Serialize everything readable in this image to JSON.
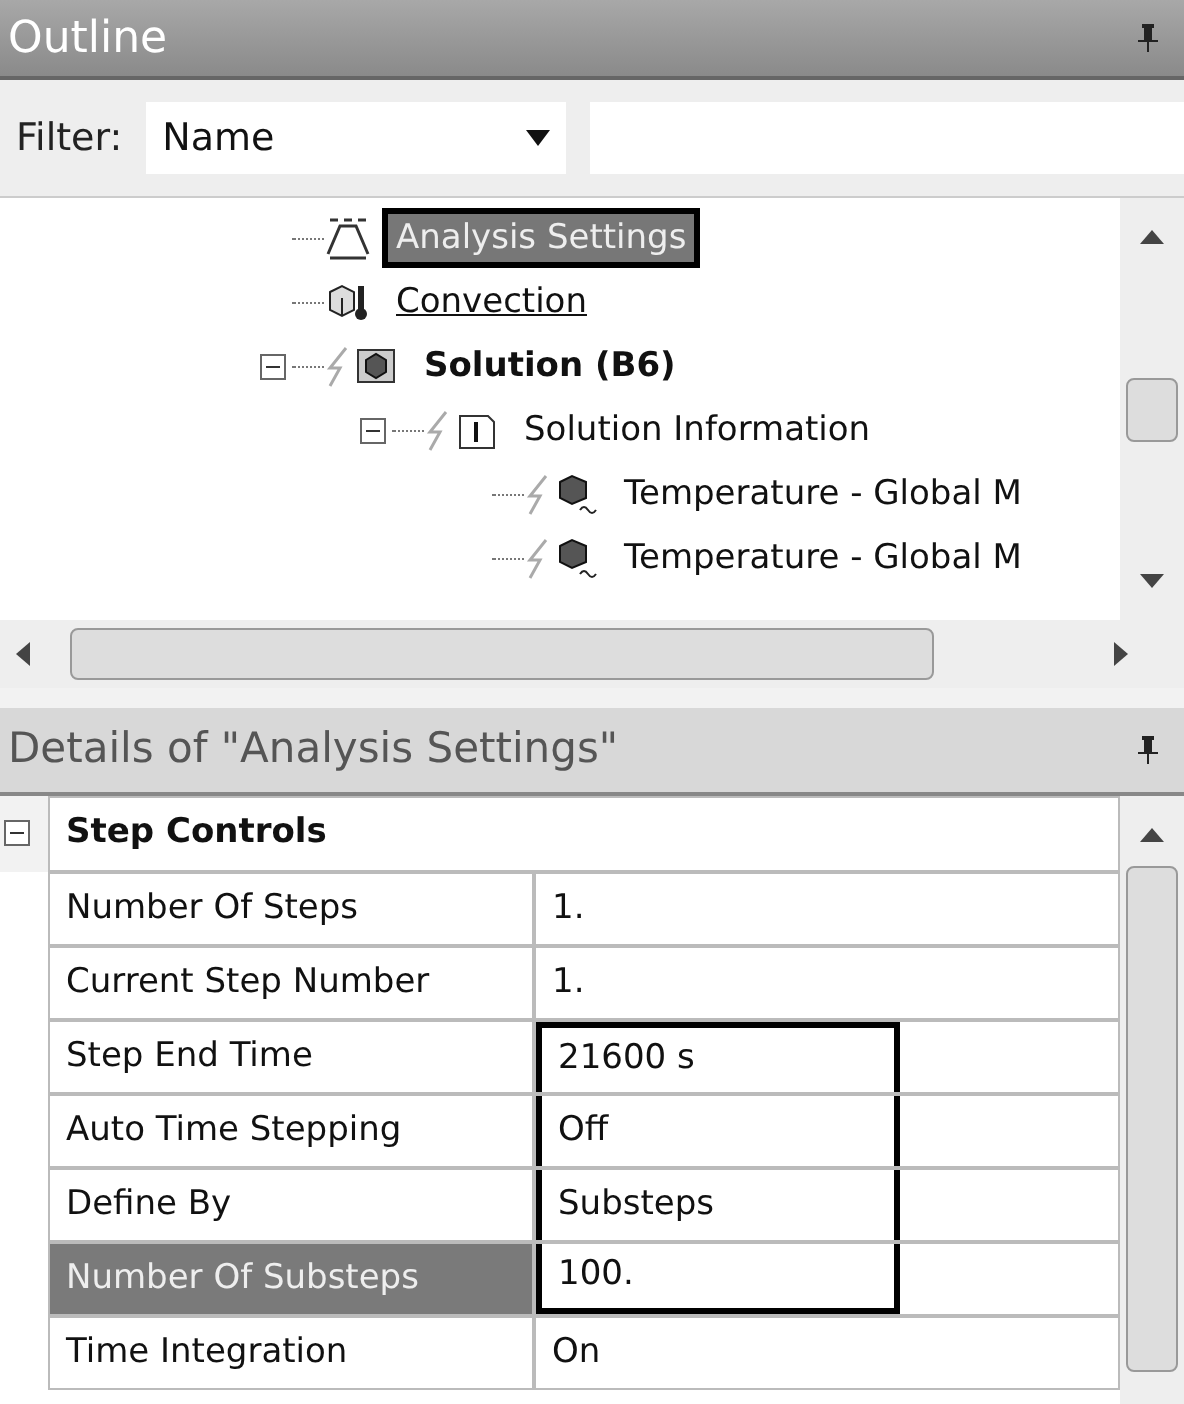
{
  "outline": {
    "title": "Outline",
    "filter_label": "Filter:",
    "filter_value": "Name",
    "tree": [
      {
        "label": "Analysis Settings",
        "kind": "settings",
        "selected": true,
        "framed": true,
        "underlined": false,
        "bold": false
      },
      {
        "label": "Convection",
        "kind": "load",
        "selected": false,
        "framed": false,
        "underlined": true,
        "bold": false
      },
      {
        "label": "Solution (B6)",
        "kind": "solution",
        "selected": false,
        "framed": false,
        "underlined": false,
        "bold": true,
        "expanded": true,
        "children": [
          {
            "label": "Solution Information",
            "kind": "info",
            "selected": false,
            "framed": false,
            "underlined": false,
            "bold": false,
            "expanded": true,
            "children": [
              {
                "label": "Temperature - Global M",
                "kind": "result",
                "selected": false,
                "framed": false,
                "underlined": false,
                "bold": false
              },
              {
                "label": "Temperature - Global M",
                "kind": "result",
                "selected": false,
                "framed": false,
                "underlined": false,
                "bold": false
              }
            ]
          }
        ]
      }
    ]
  },
  "details": {
    "title": "Details of \"Analysis Settings\"",
    "group": {
      "label": "Step Controls",
      "expanded": true
    },
    "rows": [
      {
        "label": "Number Of Steps",
        "value": "1.",
        "selected": false,
        "framed": false
      },
      {
        "label": "Current Step Number",
        "value": "1.",
        "selected": false,
        "framed": false
      },
      {
        "label": "Step End Time",
        "value": "21600 s",
        "selected": false,
        "framed": true
      },
      {
        "label": "Auto Time Stepping",
        "value": "Off",
        "selected": false,
        "framed": true
      },
      {
        "label": "Define By",
        "value": "Substeps",
        "selected": false,
        "framed": true
      },
      {
        "label": "Number Of Substeps",
        "value": "100.",
        "selected": true,
        "framed": true
      },
      {
        "label": "Time Integration",
        "value": "On",
        "selected": false,
        "framed": false
      }
    ]
  }
}
